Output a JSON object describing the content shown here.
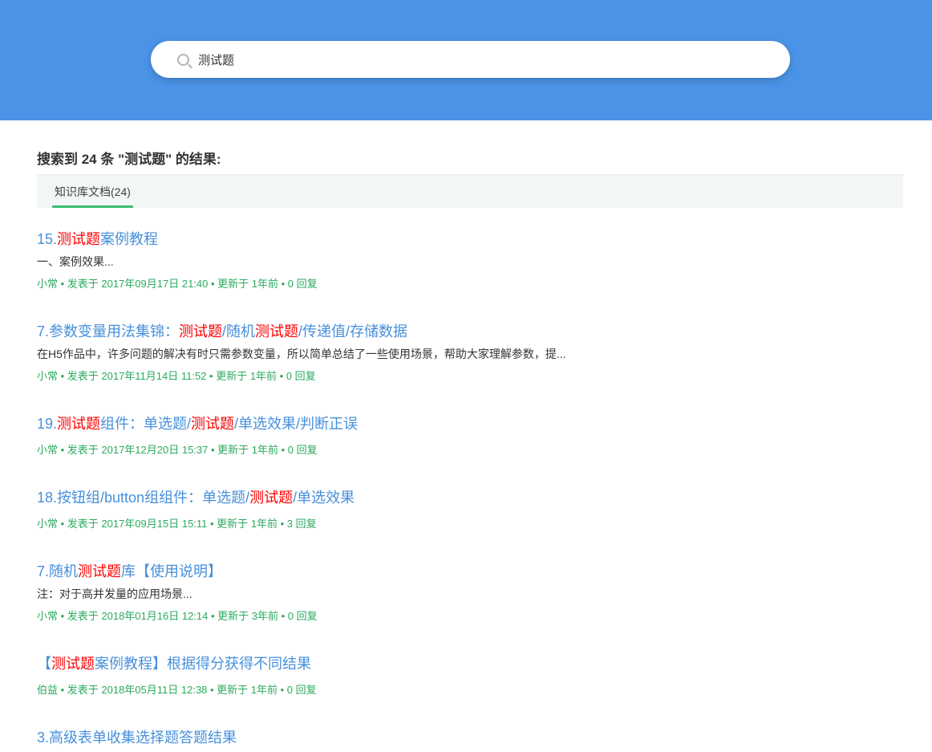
{
  "header": {
    "search": {
      "value": "测试题",
      "icon": "search-icon"
    }
  },
  "summary": "搜索到 24 条 \"测试题\" 的结果:",
  "tabs": [
    {
      "label": "知识库文档(24)",
      "active": true
    }
  ],
  "meta_separator": "•",
  "colors": {
    "header_bg": "#4B93E6",
    "link_blue": "#4790DB",
    "hl_red": "#FF0000",
    "meta_green": "#2BAA5E",
    "tab_underline": "#3CBE70",
    "tabbar_bg": "#F3F6F7",
    "tabbar_border": "#E6EAEB",
    "text_dark": "#333333",
    "icon_gray": "#B3B3B3"
  },
  "results": [
    {
      "title_segments": [
        {
          "text": "15.",
          "highlight": false
        },
        {
          "text": "测试题",
          "highlight": true
        },
        {
          "text": "案例教程",
          "highlight": false
        }
      ],
      "snippet": "一、案例效果...",
      "meta": {
        "author": "小常",
        "posted": "发表于 2017年09月17日 21:40",
        "updated": "更新于 1年前",
        "replies": "0 回复"
      }
    },
    {
      "title_segments": [
        {
          "text": "7.参数变量用法集锦：",
          "highlight": false
        },
        {
          "text": "测试题",
          "highlight": true
        },
        {
          "text": "/随机",
          "highlight": false
        },
        {
          "text": "测试题",
          "highlight": true
        },
        {
          "text": "/传递值/存储数据",
          "highlight": false
        }
      ],
      "snippet": "在H5作品中，许多问题的解决有时只需参数变量，所以简单总结了一些使用场景，帮助大家理解参数，提...",
      "meta": {
        "author": "小常",
        "posted": "发表于 2017年11月14日 11:52",
        "updated": "更新于 1年前",
        "replies": "0 回复"
      }
    },
    {
      "title_segments": [
        {
          "text": "19.",
          "highlight": false
        },
        {
          "text": "测试题",
          "highlight": true
        },
        {
          "text": "组件：单选题/",
          "highlight": false
        },
        {
          "text": "测试题",
          "highlight": true
        },
        {
          "text": "/单选效果/判断正误",
          "highlight": false
        }
      ],
      "snippet": null,
      "meta": {
        "author": "小常",
        "posted": "发表于 2017年12月20日 15:37",
        "updated": "更新于 1年前",
        "replies": "0 回复"
      }
    },
    {
      "title_segments": [
        {
          "text": "18.按钮组/button组组件：单选题/",
          "highlight": false
        },
        {
          "text": "测试题",
          "highlight": true
        },
        {
          "text": "/单选效果",
          "highlight": false
        }
      ],
      "snippet": null,
      "meta": {
        "author": "小常",
        "posted": "发表于 2017年09月15日 15:11",
        "updated": "更新于 1年前",
        "replies": "3 回复"
      }
    },
    {
      "title_segments": [
        {
          "text": "7.随机",
          "highlight": false
        },
        {
          "text": "测试题",
          "highlight": true
        },
        {
          "text": "库【使用说明】",
          "highlight": false
        }
      ],
      "snippet": "注：对于高并发量的应用场景...",
      "meta": {
        "author": "小常",
        "posted": "发表于 2018年01月16日 12:14",
        "updated": "更新于 3年前",
        "replies": "0 回复"
      }
    },
    {
      "title_segments": [
        {
          "text": "【",
          "highlight": false
        },
        {
          "text": "测试题",
          "highlight": true
        },
        {
          "text": "案例教程】根据得分获得不同结果",
          "highlight": false
        }
      ],
      "snippet": null,
      "meta": {
        "author": "伯益",
        "posted": "发表于 2018年05月11日 12:38",
        "updated": "更新于 1年前",
        "replies": "0 回复"
      }
    },
    {
      "title_segments": [
        {
          "text": "3.高级表单收集选择题答题结果",
          "highlight": false
        }
      ],
      "snippet": null,
      "meta": null
    }
  ]
}
